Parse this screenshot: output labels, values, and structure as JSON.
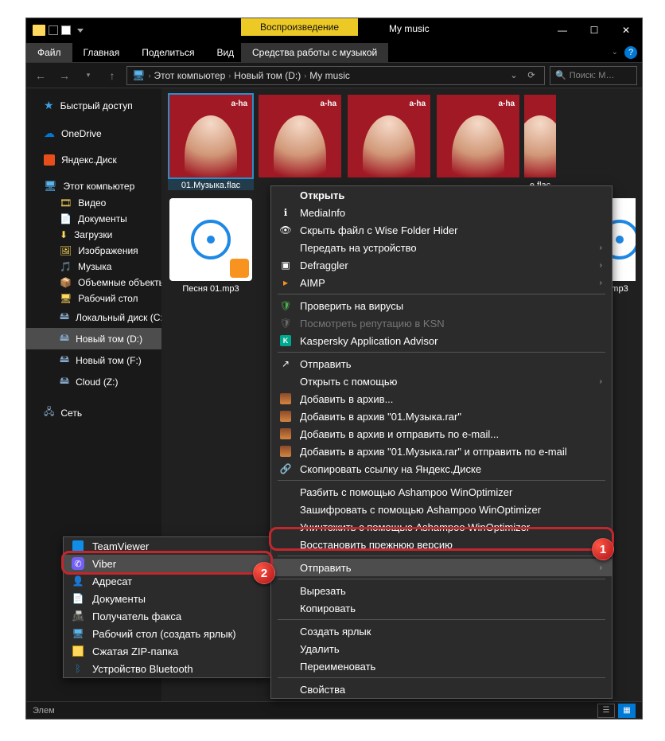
{
  "window": {
    "contextual_tab": "Воспроизведение",
    "title": "My music"
  },
  "ribbon": {
    "file": "Файл",
    "home": "Главная",
    "share": "Поделиться",
    "view": "Вид",
    "music_tools": "Средства работы с музыкой"
  },
  "breadcrumb": {
    "root": "Этот компьютер",
    "drive": "Новый том (D:)",
    "folder": "My music"
  },
  "search_placeholder": "Поиск: M…",
  "sidebar": {
    "quick_access": "Быстрый доступ",
    "onedrive": "OneDrive",
    "yandex_disk": "Яндекс.Диск",
    "this_pc": "Этот компьютер",
    "videos": "Видео",
    "documents": "Документы",
    "downloads": "Загрузки",
    "pictures": "Изображения",
    "music": "Музыка",
    "objects3d": "Объемные объекты",
    "desktop": "Рабочий стол",
    "local_c": "Локальный диск (C:)",
    "new_d": "Новый том (D:)",
    "new_f": "Новый том (F:)",
    "cloud_z": "Cloud (Z:)",
    "network": "Сеть"
  },
  "files": {
    "f1": "01.Музыка.flac",
    "f5_suffix": "е.flac",
    "song1": "Песня 01.mp3",
    "song_suffix": "mp3"
  },
  "context_menu": {
    "open": "Открыть",
    "mediainfo": "MediaInfo",
    "wise_hide": "Скрыть файл с Wise Folder Hider",
    "cast": "Передать на устройство",
    "defraggler": "Defraggler",
    "aimp": "AIMP",
    "virus_check": "Проверить на вирусы",
    "ksn": "Посмотреть репутацию в KSN",
    "kav_advisor": "Kaspersky Application Advisor",
    "send1": "Отправить",
    "open_with": "Открыть с помощью",
    "add_archive": "Добавить в архив...",
    "add_archive_named": "Добавить в архив \"01.Музыка.rar\"",
    "add_email": "Добавить в архив и отправить по e-mail...",
    "add_named_email": "Добавить в архив \"01.Музыка.rar\" и отправить по e-mail",
    "yadisk_copy": "Скопировать ссылку на Яндекс.Диске",
    "ash_split": "Разбить с помощью Ashampoo WinOptimizer",
    "ash_encrypt": "Зашифровать с помощью Ashampoo WinOptimizer",
    "ash_destroy": "Уничтожить с помощью Ashampoo WinOptimizer",
    "restore": "Восстановить прежнюю версию",
    "send_to": "Отправить",
    "cut": "Вырезать",
    "copy": "Копировать",
    "shortcut": "Создать ярлык",
    "delete": "Удалить",
    "rename": "Переименовать",
    "properties": "Свойства"
  },
  "submenu": {
    "teamviewer": "TeamViewer",
    "viber": "Viber",
    "addressbook": "Адресат",
    "documents": "Документы",
    "fax": "Получатель факса",
    "desktop_shortcut": "Рабочий стол (создать ярлык)",
    "zip": "Сжатая ZIP-папка",
    "bluetooth": "Устройство Bluetooth"
  },
  "statusbar": {
    "left": "Элем"
  },
  "badges": {
    "one": "1",
    "two": "2"
  }
}
